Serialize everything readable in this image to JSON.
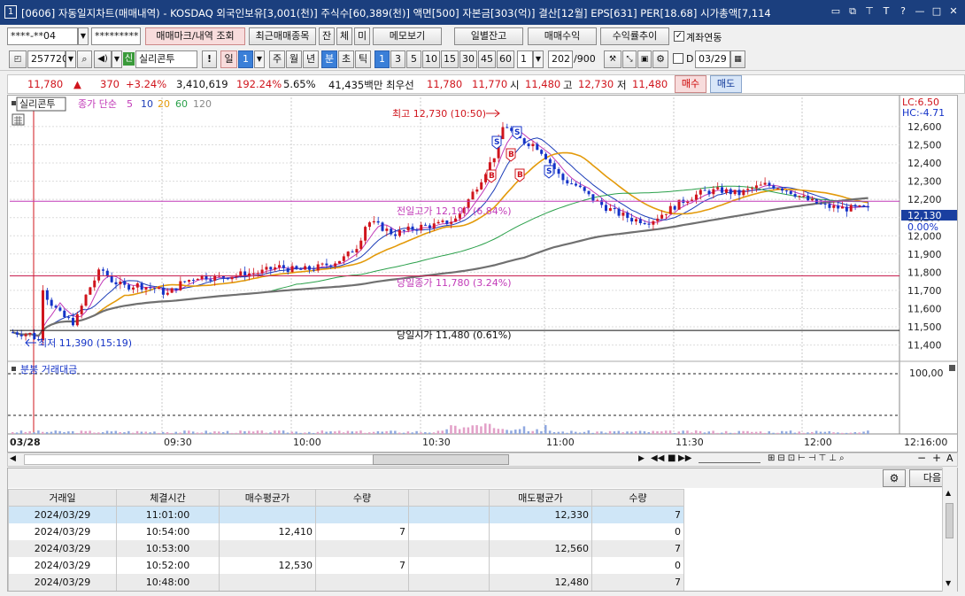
{
  "titlebar": {
    "icon": "1",
    "title": "[0606] 자동일지차트(매매내역) - KOSDAQ 외국인보유[3,001(천)] 주식수[60,389(천)] 액면[500] 자본금[303(억)] 결산[12월] EPS[631] PER[18.68] 시가총액[7,114"
  },
  "toolbar1": {
    "account": "****-**04",
    "password": "*********",
    "trade_mark_btn": "매매마크/내역 조회",
    "recent_btn": "최근매매종목",
    "tab_jan": "잔",
    "tab_che": "체",
    "tab_mi": "미",
    "memo_btn": "메모보기",
    "daily_btn": "일별잔고",
    "profit_btn": "매매수익",
    "rate_btn": "수익률추이",
    "link_label": "계좌연동"
  },
  "toolbar2": {
    "code": "257720",
    "shin": "신",
    "name": "실리콘투",
    "excl": "!",
    "period_day": "일",
    "period_num": "1",
    "periods": [
      "주",
      "월",
      "년"
    ],
    "periods2": [
      "분",
      "초",
      "틱"
    ],
    "minutes": [
      "1",
      "3",
      "5",
      "10",
      "15",
      "30",
      "45",
      "60"
    ],
    "interval": "1",
    "count": "202",
    "total": "/900",
    "d_label": "D",
    "date": "03/29"
  },
  "quote": {
    "price": "11,780",
    "arrow": "▲",
    "change": "370",
    "pct": "+3.24%",
    "volume": "3,410,619",
    "vol_ratio": "192.24%",
    "turnover": "5.65%",
    "amount": "41,435백만",
    "best_label": "최우선",
    "ask": "11,780",
    "bid": "11,770",
    "open_label": "시",
    "open": "11,480",
    "high_label": "고",
    "high": "12,730",
    "low_label": "저",
    "low": "11,480",
    "buy_btn": "매수",
    "sell_btn": "매도"
  },
  "chart": {
    "stock_tag": "실리콘투",
    "ma_label": "종가 단순",
    "ma_periods": [
      "5",
      "10",
      "20",
      "60",
      "120"
    ],
    "ma_colors": [
      "#c23ab8",
      "#1c3db8",
      "#e39a0a",
      "#2aa04a",
      "#707070"
    ],
    "lc": "LC:6.50",
    "hc": "HC:-4.71",
    "price_ticks": [
      "12,600",
      "12,500",
      "12,400",
      "12,300",
      "12,200",
      "12,100",
      "12,000",
      "11,900",
      "11,800",
      "11,700",
      "11,600",
      "11,500",
      "11,400"
    ],
    "current_price": "12,130",
    "current_pct": "0.00%",
    "high_note": "최고 12,730 (10:50)",
    "low_note": "최저 11,390 (15:19)",
    "prev_high_note": "전일고가 12,190 (6.84%)",
    "close_note": "당일종가 11,780 (3.24%)",
    "open_note": "당일시가 11,480 (0.61%)",
    "volume_label": "분봉 거래대금",
    "vol_axis": "100,00",
    "time_labels": [
      "03/28",
      "09:30",
      "10:00",
      "10:30",
      "11:00",
      "11:30",
      "12:00",
      "12:16:00"
    ]
  },
  "chart_data": {
    "type": "candlestick",
    "title": "실리콘투",
    "y_ticks": [
      11400,
      11500,
      11600,
      11700,
      11800,
      11900,
      12000,
      12100,
      12200,
      12300,
      12400,
      12500,
      12600
    ],
    "ylim": [
      11330,
      12760
    ],
    "reference_lines": [
      {
        "label": "전일고가",
        "value": 12190
      },
      {
        "label": "당일종가",
        "value": 11780
      },
      {
        "label": "당일시가",
        "value": 11480
      }
    ],
    "high": {
      "value": 12730,
      "time": "10:50"
    },
    "low": {
      "value": 11390,
      "time": "15:19"
    },
    "current": 12130
  },
  "grid": {
    "next_btn": "다음",
    "headers": [
      "거래일",
      "체결시간",
      "매수평균가",
      "수량",
      "",
      "매도평균가",
      "수량"
    ],
    "rows": [
      {
        "date": "2024/03/29",
        "time": "11:01:00",
        "buy": "",
        "bqty": "",
        "sell": "12,330",
        "sqty": "7"
      },
      {
        "date": "2024/03/29",
        "time": "10:54:00",
        "buy": "12,410",
        "bqty": "7",
        "sell": "",
        "sqty": "0"
      },
      {
        "date": "2024/03/29",
        "time": "10:53:00",
        "buy": "",
        "bqty": "",
        "sell": "12,560",
        "sqty": "7"
      },
      {
        "date": "2024/03/29",
        "time": "10:52:00",
        "buy": "12,530",
        "bqty": "7",
        "sell": "",
        "sqty": "0"
      },
      {
        "date": "2024/03/29",
        "time": "10:48:00",
        "buy": "",
        "bqty": "",
        "sell": "12,480",
        "sqty": "7"
      }
    ]
  }
}
